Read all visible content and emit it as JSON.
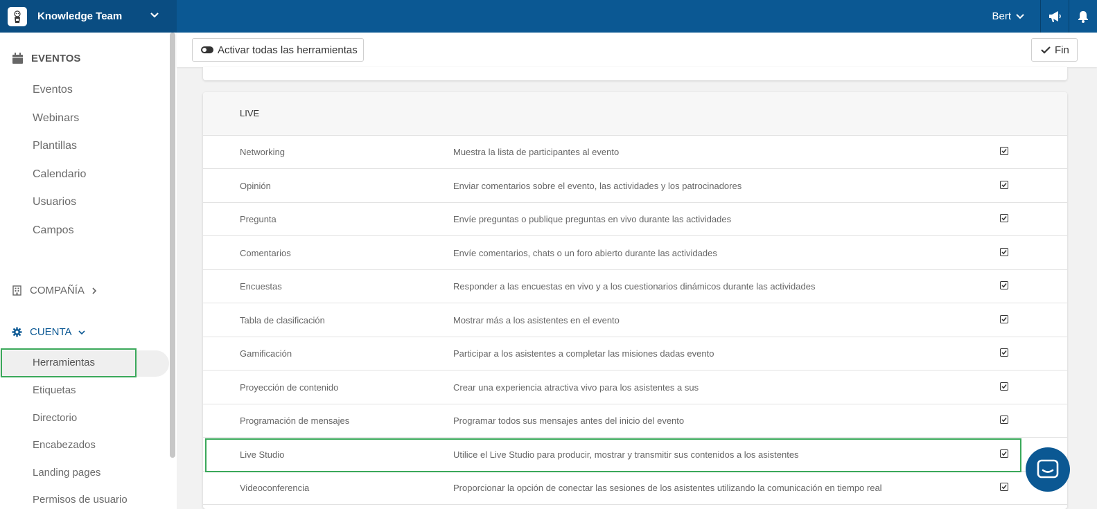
{
  "topbar": {
    "team_name": "Knowledge Team",
    "user_name": "Bert",
    "icons": [
      "logo-icon",
      "chevron-down-icon",
      "megaphone-icon",
      "bell-icon"
    ]
  },
  "sidebar": {
    "eventos_header": "EVENTOS",
    "eventos_items": [
      "Eventos",
      "Webinars",
      "Plantillas",
      "Calendario",
      "Usuarios",
      "Campos"
    ],
    "compania_header": "COMPAÑÍA",
    "cuenta_header": "CUENTA",
    "cuenta_items": [
      "Herramientas",
      "Etiquetas",
      "Directorio",
      "Encabezados",
      "Landing pages",
      "Permisos de usuario"
    ],
    "active_item": "Herramientas"
  },
  "toolbar": {
    "activate_label": "Activar todas las herramientas",
    "fin_label": "Fin"
  },
  "section": {
    "title": "LIVE",
    "rows": [
      {
        "name": "Networking",
        "desc": "Muestra la lista de participantes al evento",
        "checked": true
      },
      {
        "name": "Opinión",
        "desc": "Enviar comentarios sobre el evento, las actividades y los patrocinadores",
        "checked": true
      },
      {
        "name": "Pregunta",
        "desc": "Envíe preguntas o publique preguntas en vivo durante las actividades",
        "checked": true
      },
      {
        "name": "Comentarios",
        "desc": "Envíe comentarios, chats o un foro abierto durante las actividades",
        "checked": true
      },
      {
        "name": "Encuestas",
        "desc": "Responder a las encuestas en vivo y a los cuestionarios dinámicos durante las actividades",
        "checked": true
      },
      {
        "name": "Tabla de clasificación",
        "desc": "Mostrar más a los asistentes en el evento",
        "checked": true
      },
      {
        "name": "Gamificación",
        "desc": "Participar a los asistentes a completar las misiones dadas evento",
        "checked": true
      },
      {
        "name": "Proyección de contenido",
        "desc": "Crear una experiencia atractiva vivo para los asistentes a sus",
        "checked": true
      },
      {
        "name": "Programación de mensajes",
        "desc": "Programar todos sus mensajes antes del inicio del evento",
        "checked": true
      },
      {
        "name": "Live Studio",
        "desc": "Utilice el Live Studio para producir, mostrar y transmitir sus contenidos a los asistentes",
        "checked": true
      },
      {
        "name": "Videoconferencia",
        "desc": "Proporcionar la opción de conectar las sesiones de los asistentes utilizando la comunicación en tiempo real",
        "checked": true
      }
    ]
  },
  "colors": {
    "topbar": "#0b5893",
    "brand_bg": "#0a4d82",
    "highlight": "#3aa85a",
    "accent_link": "#0b5893"
  }
}
